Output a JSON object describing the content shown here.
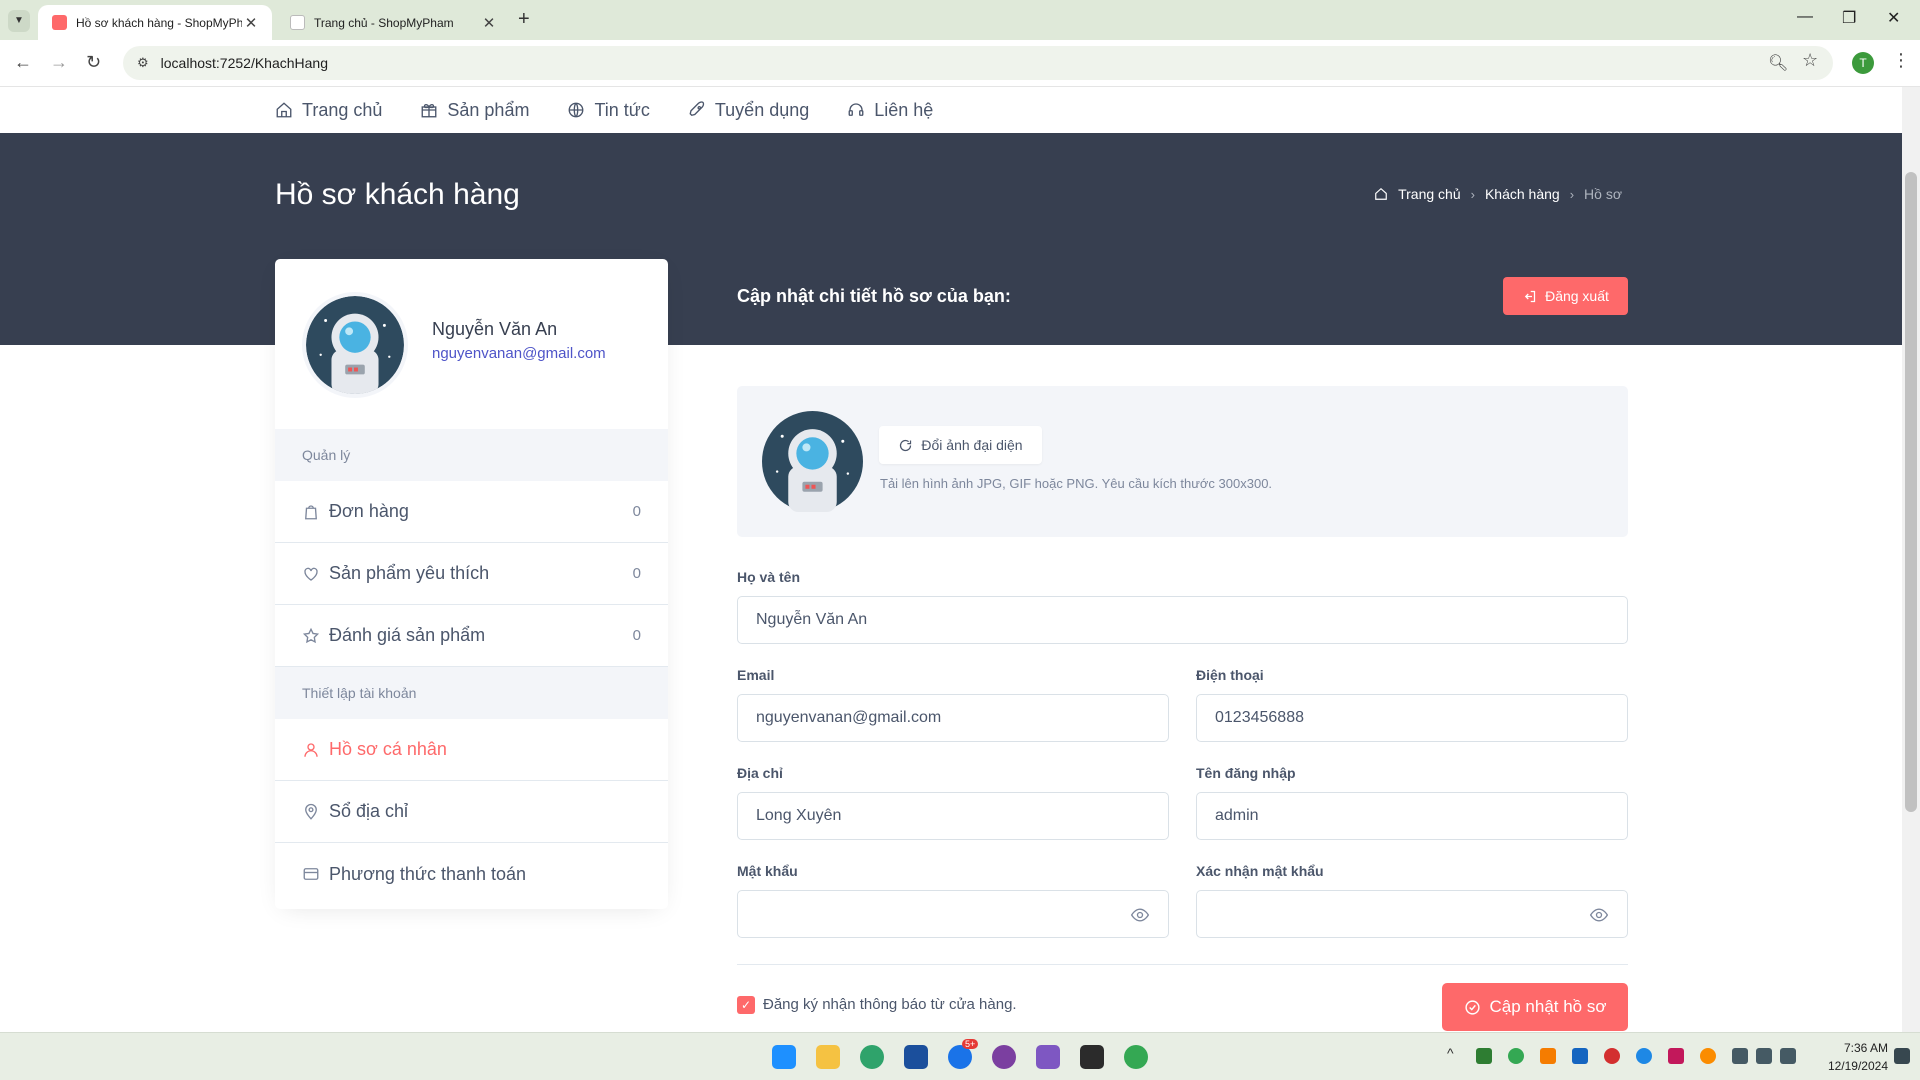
{
  "browser": {
    "tabs": [
      {
        "title": "Hồ sơ khách hàng - ShopMyPh",
        "active": true
      },
      {
        "title": "Trang chủ - ShopMyPham",
        "active": false
      }
    ],
    "url": "localhost:7252/KhachHang",
    "profile_initial": "T"
  },
  "site_nav": [
    {
      "label": "Trang chủ",
      "icon": "home-icon"
    },
    {
      "label": "Sản phẩm",
      "icon": "gift-icon"
    },
    {
      "label": "Tin tức",
      "icon": "globe-icon"
    },
    {
      "label": "Tuyển dụng",
      "icon": "rocket-icon"
    },
    {
      "label": "Liên hệ",
      "icon": "headset-icon"
    }
  ],
  "hero": {
    "title": "Hồ sơ khách hàng",
    "breadcrumb": [
      "Trang chủ",
      "Khách hàng",
      "Hồ sơ"
    ],
    "section_heading": "Cập nhật chi tiết hồ sơ của bạn:",
    "logout_label": "Đăng xuất"
  },
  "sidebar": {
    "name": "Nguyễn Văn An",
    "email": "nguyenvanan@gmail.com",
    "section_manage": "Quản lý",
    "manage_items": [
      {
        "label": "Đơn hàng",
        "count": "0",
        "icon": "bag-icon"
      },
      {
        "label": "Sản phẩm yêu thích",
        "count": "0",
        "icon": "heart-icon"
      },
      {
        "label": "Đánh giá sản phẩm",
        "count": "0",
        "icon": "star-icon"
      }
    ],
    "section_account": "Thiết lập tài khoản",
    "account_items": [
      {
        "label": "Hồ sơ cá nhân",
        "icon": "user-icon",
        "active": true
      },
      {
        "label": "Sổ địa chỉ",
        "icon": "map-pin-icon"
      },
      {
        "label": "Phương thức thanh toán",
        "icon": "credit-card-icon"
      }
    ]
  },
  "upload": {
    "button_label": "Đổi ảnh đại diện",
    "hint": "Tải lên hình ảnh JPG, GIF hoặc PNG. Yêu cầu kích thước 300x300."
  },
  "form": {
    "fullname_label": "Họ và tên",
    "fullname_value": "Nguyễn Văn An",
    "email_label": "Email",
    "email_value": "nguyenvanan@gmail.com",
    "phone_label": "Điện thoại",
    "phone_value": "0123456888",
    "address_label": "Địa chỉ",
    "address_value": "Long Xuyên",
    "username_label": "Tên đăng nhập",
    "username_value": "admin",
    "password_label": "Mật khẩu",
    "password_value": "",
    "confirm_label": "Xác nhận mật khẩu",
    "confirm_value": "",
    "newsletter_label": "Đăng ký nhận thông báo từ cửa hàng.",
    "newsletter_checked": true,
    "submit_label": "Cập nhật hồ sơ"
  },
  "taskbar": {
    "time": "7:36 AM",
    "date": "12/19/2024",
    "badge": "5+"
  },
  "colors": {
    "accent": "#fe696a",
    "hero_bg": "#373f50",
    "link": "#4e54c8"
  }
}
